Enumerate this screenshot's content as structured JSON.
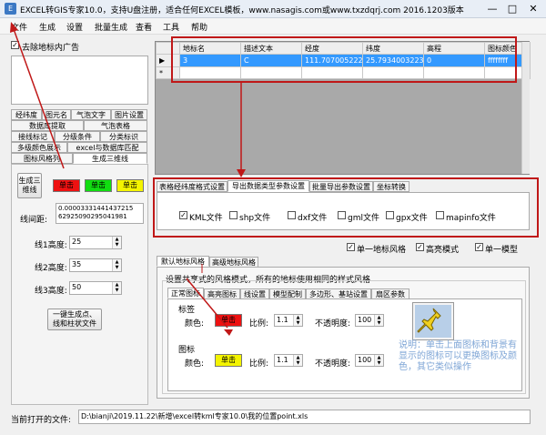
{
  "window": {
    "title": "EXCEL转GIS专家10.0，支持U盘注册，适合任何EXCEL模板，www.nasagis.com或www.txzdqrj.com 2016.1203版本",
    "btn_min": "—",
    "btn_max": "□",
    "btn_close": "✕"
  },
  "menu": [
    "文件",
    "生成",
    "设置",
    "批量生成",
    "查看",
    "工具",
    "帮助"
  ],
  "left": {
    "remove_ad_label": "去除地标内广告",
    "tabs_row1": [
      "经纬度",
      "图元名",
      "气泡文字",
      "图片设置"
    ],
    "tabs_row2": [
      "数据库提取",
      "气泡表格"
    ],
    "tabs_row3": [
      "接线标记",
      "分级条件",
      "分类标识"
    ],
    "tabs_row4": [
      "多级颜色展示",
      "excel与数据库匹配"
    ],
    "tabs_row5": [
      "图标风格列",
      "生成三维线"
    ],
    "gen_btn": "生成三\n维线",
    "colors": [
      "单击",
      "单击",
      "单击"
    ],
    "interval_label": "线间距:",
    "interval_value": "0.00003331441437215\n62925090295041981",
    "line1_label": "线1高度:",
    "line1_value": "25",
    "line2_label": "线2高度:",
    "line2_value": "35",
    "line3_label": "线3高度:",
    "line3_value": "50",
    "one_click_btn": "一键生成点、\n线和柱状文件"
  },
  "grid": {
    "columns": [
      "地标名",
      "描述文本",
      "经度",
      "纬度",
      "高程",
      "图标颜色"
    ],
    "rows": [
      [
        "3",
        "C",
        "111.7070052223",
        "25.7934003223",
        "0",
        "ffffffff"
      ]
    ]
  },
  "export": {
    "tabs": [
      "表格经纬度格式设置",
      "导出数据类型参数设置",
      "批量导出参数设置",
      "坐标转换"
    ],
    "types": [
      {
        "label": "KML文件",
        "checked": true
      },
      {
        "label": "shp文件",
        "checked": false
      },
      {
        "label": "dxf文件",
        "checked": false
      },
      {
        "label": "gml文件",
        "checked": false
      },
      {
        "label": "gpx文件",
        "checked": false
      },
      {
        "label": "mapinfo文件",
        "checked": false
      }
    ]
  },
  "options": [
    {
      "label": "单一地标风格",
      "checked": true
    },
    {
      "label": "高亮模式",
      "checked": true
    },
    {
      "label": "单一模型",
      "checked": true
    }
  ],
  "style": {
    "tabs": [
      "默认地标风格",
      "高级地标风格"
    ],
    "group_title": "设置共享式的风格模式，所有的地标使用相同的样式风格",
    "subtabs": [
      "正常图标",
      "高亮图标",
      "线设置",
      "模型配制",
      "多边形、基站设置",
      "扇区参数"
    ],
    "label_section": "标签",
    "icon_section": "图标",
    "color_label": "颜色:",
    "label_color_btn": "单击",
    "icon_color_btn": "单击",
    "scale_label": "比例:",
    "label_scale": "1.1",
    "icon_scale": "1.1",
    "opacity_label": "不透明度:",
    "label_opacity": "100",
    "icon_opacity": "100",
    "hint": "说明：单击上面图标和背景有显示的图标可以更换图标及颜色，其它类似操作"
  },
  "status": {
    "label": "当前打开的文件:",
    "path": "D:\\bianji\\2019.11.22\\新增\\excel转kml专家10.0\\我的位置point.xls"
  },
  "colors": {
    "red": "#ee1111",
    "green": "#11dd11",
    "yellow": "#f4f400",
    "selection": "#3399ff",
    "annot": "#c01818"
  }
}
